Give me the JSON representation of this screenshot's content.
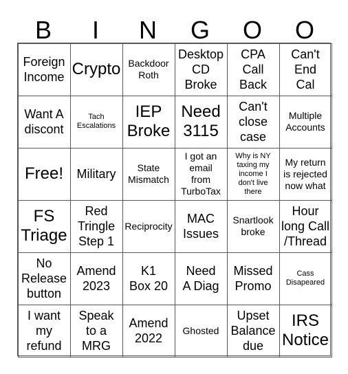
{
  "header": [
    "B",
    "I",
    "N",
    "G",
    "O",
    "O"
  ],
  "cells": [
    "Foreign\nIncome",
    "Crypto",
    "Backdoor\nRoth",
    "Desktop\nCD\nBroke",
    "CPA\nCall\nBack",
    "Can't\nEnd\nCal",
    "Want A\ndiscont",
    "Tach\nEscalations",
    "IEP\nBroke",
    "Need\n3115",
    "Can't\nclose\ncase",
    "Multiple\nAccounts",
    "Free!",
    "Military",
    "State\nMismatch",
    "I got an\nemail\nfrom\nTurboTax",
    "Why is NY\ntaxing my\nincome I\ndon't live\nthere",
    "My return\nis rejected\nnow what",
    "FS\nTriage",
    "Red\nTringle\nStep 1",
    "Reciprocity",
    "MAC\nIssues",
    "Snartlook\nbroke",
    "Hour\nlong Call\n/Thread",
    "No\nRelease\nbutton",
    "Amend\n2023",
    "K1\nBox 20",
    "Need\nA Diag",
    "Missed\nPromo",
    "Cass\nDisapeared",
    "I want\nmy\nrefund",
    "Speak\nto a\nMRG",
    "Amend\n2022",
    "Ghosted",
    "Upset\nBalance\ndue",
    "IRS\nNotice"
  ]
}
